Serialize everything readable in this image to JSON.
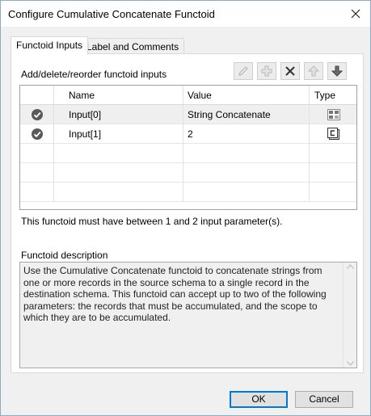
{
  "window": {
    "title": "Configure Cumulative Concatenate Functoid",
    "close_glyph": "✕"
  },
  "tabs": [
    {
      "label": "Functoid Inputs",
      "active": true
    },
    {
      "label": "Label and Comments",
      "active": false
    }
  ],
  "inputs_panel": {
    "caption": "Add/delete/reorder functoid inputs",
    "toolbar": [
      {
        "name": "edit-icon",
        "disabled": true
      },
      {
        "name": "add-icon",
        "disabled": true
      },
      {
        "name": "delete-icon",
        "disabled": false
      },
      {
        "name": "move-up-icon",
        "disabled": true
      },
      {
        "name": "move-down-icon",
        "disabled": false
      }
    ],
    "columns": {
      "name": "Name",
      "value": "Value",
      "type": "Type"
    },
    "rows": [
      {
        "name": "Input[0]",
        "value": "String Concatenate",
        "type_icon": "record-link-icon",
        "selected": true
      },
      {
        "name": "Input[1]",
        "value": "2",
        "type_icon": "constant-icon",
        "selected": false
      }
    ],
    "status": "This functoid must have between 1 and 2 input parameter(s)."
  },
  "description": {
    "label": "Functoid description",
    "text": "Use the Cumulative Concatenate functoid to concatenate strings from one or more records in the source schema to a single record in the destination schema. This functoid can accept up to two of the following parameters: the records that must be accumulated, and the scope to which they are to be accumulated."
  },
  "buttons": {
    "ok": "OK",
    "cancel": "Cancel"
  },
  "colors": {
    "focus_border": "#0078d7",
    "check_badge": "#5a5a5a"
  }
}
